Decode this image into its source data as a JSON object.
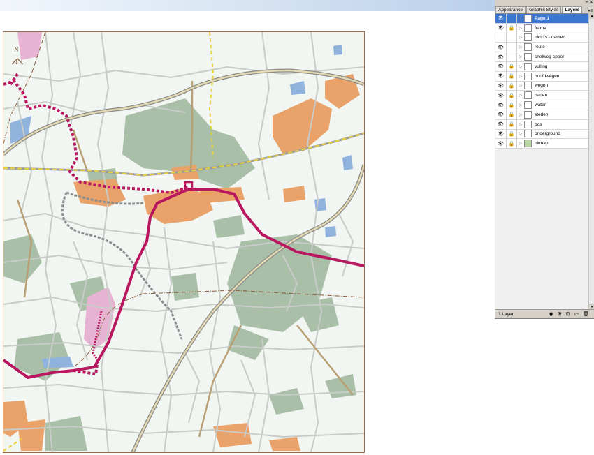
{
  "panel": {
    "tabs": [
      "Appearance",
      "Graphic Styles",
      "Layers"
    ],
    "active_tab": "Layers",
    "tab_menu_icon": "panel-menu-icon",
    "title_icons": [
      "minimize-icon",
      "close-icon"
    ],
    "title_glyphs": [
      "–",
      "×"
    ],
    "layers": [
      {
        "name": "Page 1",
        "selected": true,
        "eye": true,
        "locked": false,
        "expanded": true
      },
      {
        "name": "frame",
        "eye": true,
        "locked": true
      },
      {
        "name": "picto's - namen",
        "eye": false,
        "locked": false
      },
      {
        "name": "route",
        "eye": true,
        "locked": false
      },
      {
        "name": "snelweg-spoor",
        "eye": true,
        "locked": false
      },
      {
        "name": "vulling",
        "eye": true,
        "locked": true
      },
      {
        "name": "hoofdwegen",
        "eye": true,
        "locked": true
      },
      {
        "name": "wegen",
        "eye": true,
        "locked": true
      },
      {
        "name": "paden",
        "eye": true,
        "locked": true
      },
      {
        "name": "water",
        "eye": true,
        "locked": true
      },
      {
        "name": "steden",
        "eye": true,
        "locked": true
      },
      {
        "name": "bos",
        "eye": true,
        "locked": true
      },
      {
        "name": "onderground",
        "eye": true,
        "locked": true
      },
      {
        "name": "bitmap",
        "eye": true,
        "locked": true
      }
    ],
    "footer_label": "1 Layer"
  },
  "map": {
    "north_label": "N",
    "colors": {
      "background": "#f2f6f2",
      "forest": "#a9bfa8",
      "town": "#e9a36a",
      "road": "#c8ccc8",
      "main_road": "#b89f74",
      "motorway_fill": "#f2e3a1",
      "route": "#b8175f",
      "water": "#8fb3dd",
      "pink": "#e6b4d2",
      "rail_dash": "#e8d23c"
    }
  }
}
